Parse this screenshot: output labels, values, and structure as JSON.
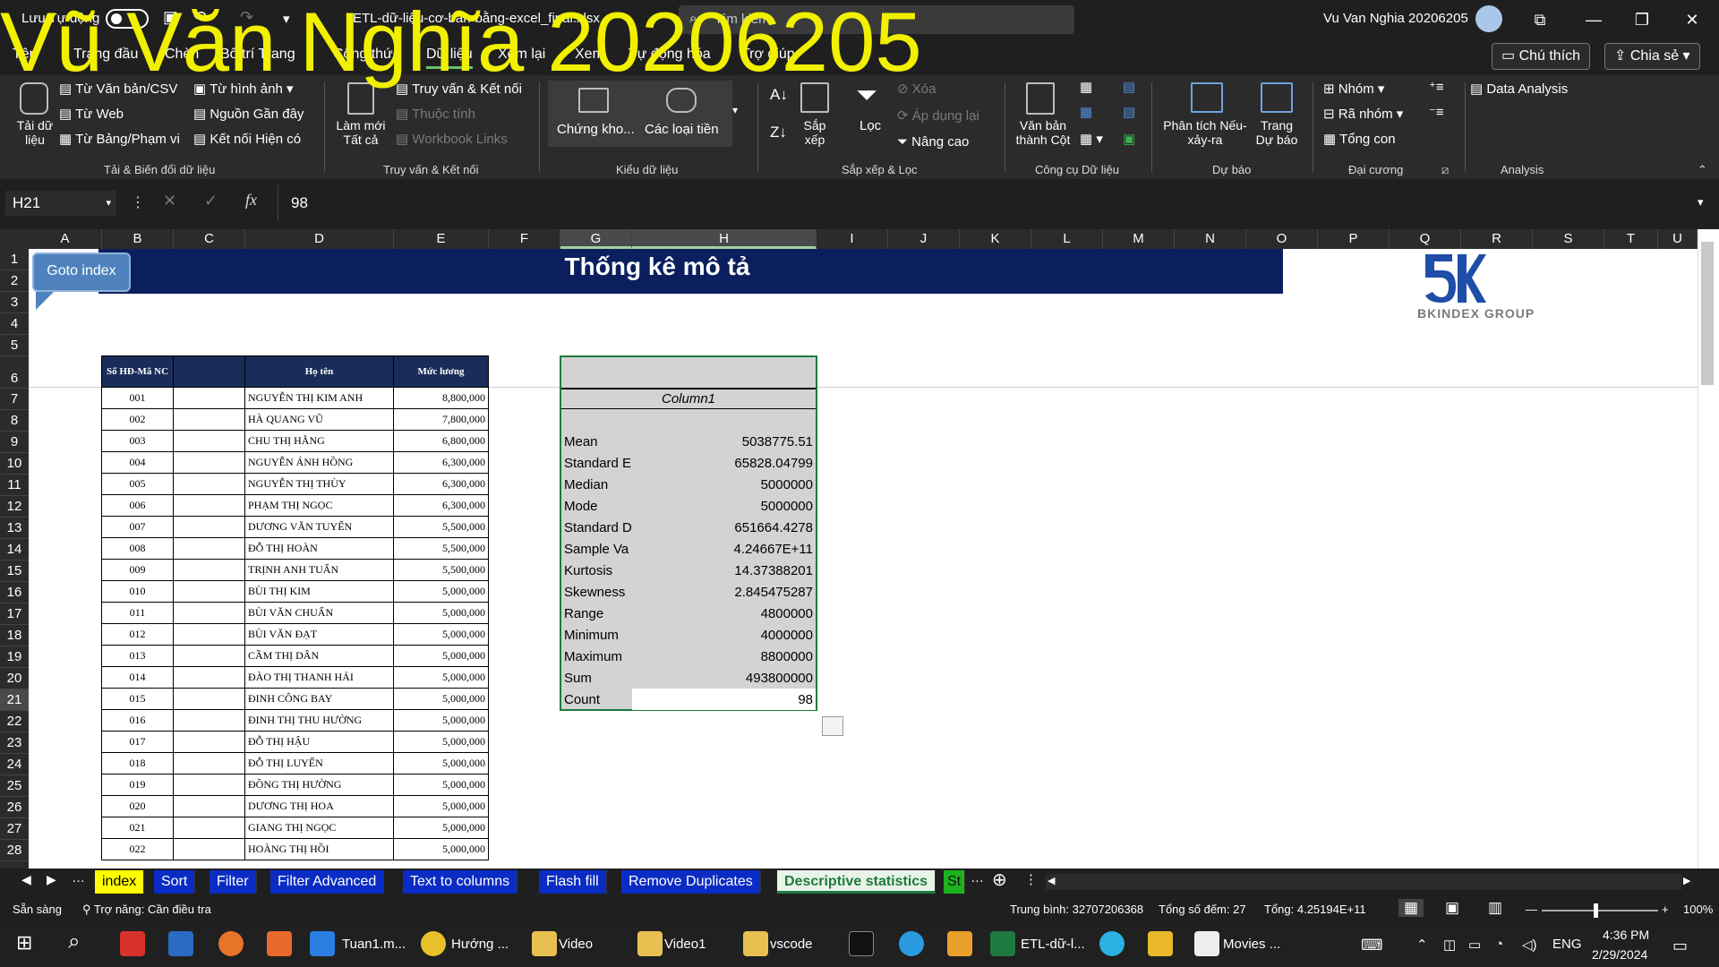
{
  "titlebar": {
    "autosave_label": "Lưu Tự động",
    "filename": "ETL-dữ-liệu-cơ-bản-bằng-excel_final.xlsx",
    "search_placeholder": "Tìm kiếm",
    "user_name": "Vu Van Nghia 20206205"
  },
  "watermark": "Vũ Văn Nghĩa 20206205",
  "ribbon_tabs": [
    "Tệp",
    "Trang đầu",
    "Chèn",
    "Bố trí Trang",
    "Công thức",
    "Dữ liệu",
    "Xem lại",
    "Xem",
    "Tự động hóa",
    "Trợ giúp"
  ],
  "share": {
    "comment_label": "Chú thích",
    "share_label": "Chia sẻ"
  },
  "ribbon": {
    "get_data": "Tải dữ liệu",
    "g1": [
      "Từ Văn bản/CSV",
      "Từ Web",
      "Từ Bảng/Phạm vi",
      "Từ hình ảnh",
      "Nguồn Gần đây",
      "Kết nối Hiện có"
    ],
    "g1_label": "Tải & Biến đổi dữ liệu",
    "refresh_all": "Làm mới Tất cả",
    "g2": [
      "Truy vấn & Kết nối",
      "Thuộc tính",
      "Workbook Links"
    ],
    "g2_label": "Truy vấn & Kết nối",
    "g3": [
      "Chứng kho...",
      "Các loại tiền"
    ],
    "g3_label": "Kiểu dữ liệu",
    "sort": "Sắp xếp",
    "filter": "Lọc",
    "g4": [
      "Xóa",
      "Áp dụng lại",
      "Nâng cao"
    ],
    "g4_label": "Sắp xếp & Lọc",
    "text_to_columns": "Văn bản thành Cột",
    "g5_label": "Công cụ Dữ liệu",
    "what_if": "Phân tích Nếu-xảy-ra",
    "forecast": "Trang Dự báo",
    "g6_label": "Dự báo",
    "g7": [
      "Nhóm",
      "Rã nhóm",
      "Tổng con"
    ],
    "g7_label": "Đại cương",
    "data_analysis": "Data Analysis",
    "g8_label": "Analysis"
  },
  "formula_bar": {
    "name_box": "H21",
    "value": "98"
  },
  "columns": [
    "A",
    "B",
    "C",
    "D",
    "E",
    "F",
    "G",
    "H",
    "I",
    "J",
    "K",
    "L",
    "M",
    "N",
    "O",
    "P",
    "Q",
    "R",
    "S",
    "T",
    "U"
  ],
  "rows": [
    "1",
    "2",
    "3",
    "4",
    "5",
    "6",
    "7",
    "8",
    "9",
    "10",
    "11",
    "12",
    "13",
    "14",
    "15",
    "16",
    "17",
    "18",
    "19",
    "20",
    "21",
    "22",
    "23",
    "24",
    "25",
    "26",
    "27",
    "28"
  ],
  "sheet": {
    "goto_label": "Goto index",
    "banner_title": "Thống kê mô tả",
    "logo_text": "BKINDEX GROUP",
    "table_headers": [
      "Số HĐ-Mã NC",
      "",
      "Họ tên",
      "Mức lương"
    ],
    "table_rows": [
      [
        "001",
        "",
        "NGUYỄN THỊ KIM ANH",
        "8,800,000"
      ],
      [
        "002",
        "",
        "HÀ QUANG VŨ",
        "7,800,000"
      ],
      [
        "003",
        "",
        "CHU THỊ HẰNG",
        "6,800,000"
      ],
      [
        "004",
        "",
        "NGUYỄN ÁNH HỒNG",
        "6,300,000"
      ],
      [
        "005",
        "",
        "NGUYỄN THỊ THÙY",
        "6,300,000"
      ],
      [
        "006",
        "",
        "PHẠM THỊ NGỌC",
        "6,300,000"
      ],
      [
        "007",
        "",
        "DƯƠNG VĂN TUYẾN",
        "5,500,000"
      ],
      [
        "008",
        "",
        "ĐỖ THỊ HOÀN",
        "5,500,000"
      ],
      [
        "009",
        "",
        "TRỊNH ANH TUẤN",
        "5,500,000"
      ],
      [
        "010",
        "",
        "BÙI THỊ KIM",
        "5,000,000"
      ],
      [
        "011",
        "",
        "BÙI VĂN CHUẨN",
        "5,000,000"
      ],
      [
        "012",
        "",
        "BÙI VĂN ĐẠT",
        "5,000,000"
      ],
      [
        "013",
        "",
        "CẦM THỊ DÂN",
        "5,000,000"
      ],
      [
        "014",
        "",
        "ĐÀO THỊ THANH HẢI",
        "5,000,000"
      ],
      [
        "015",
        "",
        "ĐINH CÔNG BAY",
        "5,000,000"
      ],
      [
        "016",
        "",
        "ĐINH THỊ THU HƯỜNG",
        "5,000,000"
      ],
      [
        "017",
        "",
        "ĐỖ THỊ HẬU",
        "5,000,000"
      ],
      [
        "018",
        "",
        "ĐỖ THỊ LUYẾN",
        "5,000,000"
      ],
      [
        "019",
        "",
        "ĐỒNG THỊ HƯỜNG",
        "5,000,000"
      ],
      [
        "020",
        "",
        "DƯƠNG THỊ HOA",
        "5,000,000"
      ],
      [
        "021",
        "",
        "GIANG THỊ NGỌC",
        "5,000,000"
      ],
      [
        "022",
        "",
        "HOÀNG THỊ HỒI",
        "5,000,000"
      ]
    ],
    "stats_header": "Column1",
    "stats": [
      [
        "Mean",
        "5038775.51"
      ],
      [
        "Standard E",
        "65828.04799"
      ],
      [
        "Median",
        "5000000"
      ],
      [
        "Mode",
        "5000000"
      ],
      [
        "Standard D",
        "651664.4278"
      ],
      [
        "Sample Va",
        "4.24667E+11"
      ],
      [
        "Kurtosis",
        "14.37388201"
      ],
      [
        "Skewness",
        "2.845475287"
      ],
      [
        "Range",
        "4800000"
      ],
      [
        "Minimum",
        "4000000"
      ],
      [
        "Maximum",
        "8800000"
      ],
      [
        "Sum",
        "493800000"
      ],
      [
        "Count",
        "98"
      ]
    ]
  },
  "sheet_tabs": [
    "index",
    "Sort",
    "Filter",
    "Filter Advanced",
    "Text to columns",
    "Flash fill",
    "Remove Duplicates",
    "Descriptive statistics",
    "St"
  ],
  "status": {
    "ready": "Sẵn sàng",
    "accessibility": "Trợ năng: Cần điều tra",
    "average": "Trung bình: 32707206368",
    "count": "Tổng số đếm: 27",
    "sum": "Tổng: 4.25194E+11",
    "zoom": "100%"
  },
  "taskbar": {
    "apps": [
      "Tuan1.m...",
      "Hướng ...",
      "Video",
      "Video1",
      "vscode",
      "ETL-dữ-l...",
      "Movies ..."
    ],
    "lang": "ENG",
    "time": "4:36 PM",
    "date": "2/29/2024"
  }
}
